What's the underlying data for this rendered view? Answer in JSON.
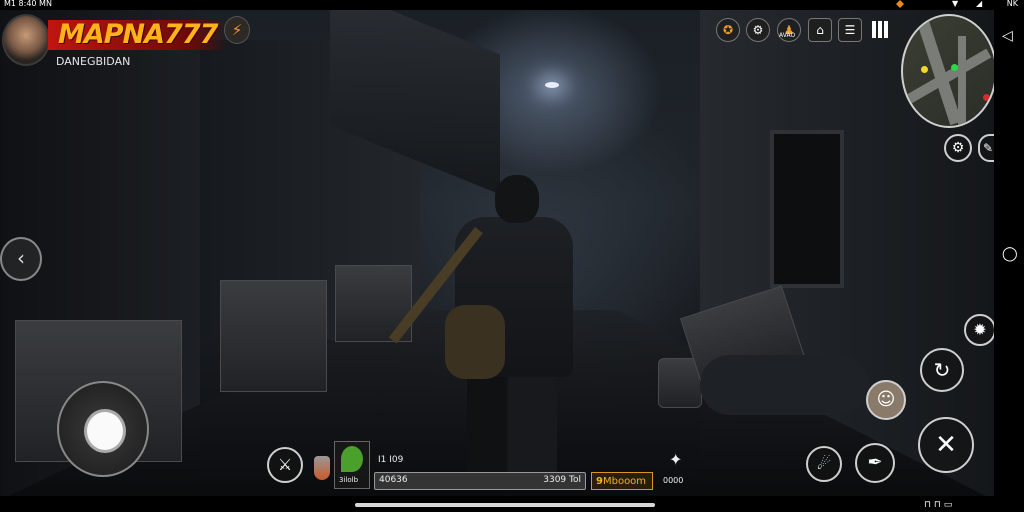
{
  "status_bar": {
    "left_text": "M1 8:40 MN",
    "right_text": "NK"
  },
  "player": {
    "name": "MAPNA777",
    "subtitle": "DANEGBIDAN",
    "bolt_icon": "lightning-icon"
  },
  "top_icons": [
    {
      "name": "medal-icon",
      "label": ""
    },
    {
      "name": "gear-badge-icon",
      "label": ""
    },
    {
      "name": "character-icon",
      "label": "AVAO"
    },
    {
      "name": "map-grid-icon",
      "label": ""
    },
    {
      "name": "chat-icon",
      "label": "▪▪"
    }
  ],
  "hud": {
    "slot_count_label": "I1 I09",
    "item_label": "3ilolb",
    "ammo_left": "40636",
    "ammo_right": "3309 Tol",
    "gold_label": "Mbooom",
    "gold_icon": "9",
    "right_small_label": "0000"
  },
  "colors": {
    "accent_orange": "#ffb21a",
    "name_bar_red": "#c01510",
    "gold_border": "#d8971b"
  }
}
